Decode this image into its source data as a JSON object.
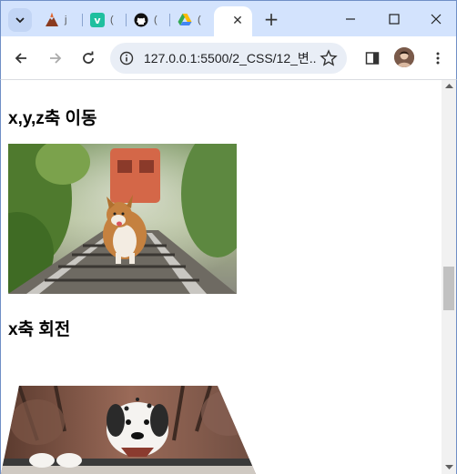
{
  "browser": {
    "tabs": [
      {
        "title": "j",
        "favicon": "volcano-icon",
        "color": "#c0552b"
      },
      {
        "title": "(",
        "favicon": "v-icon",
        "color": "#1fbf9f"
      },
      {
        "title": "(",
        "favicon": "github-icon",
        "color": "#111111"
      },
      {
        "title": "(",
        "favicon": "google-drive-icon",
        "color": "#34a853"
      }
    ],
    "active_tab": {
      "title": "",
      "close": "✕"
    },
    "new_tab": "+",
    "address": "127.0.0.1:5500/2_CSS/12_변..."
  },
  "page": {
    "heading1": "x,y,z축 이동",
    "heading2": "x축 회전"
  },
  "colors": {
    "tabstrip": "#d3e3fd",
    "omnibox": "#e9eef6",
    "scroll_thumb": "#c1c1c1"
  }
}
